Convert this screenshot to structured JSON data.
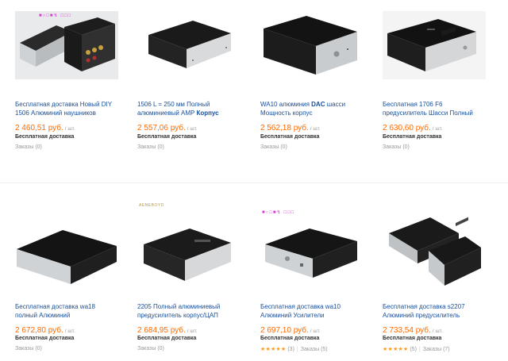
{
  "products": [
    {
      "title_lines": [
        "Бесплатная доставка Новый DIY",
        "1506 Алюминий наушников"
      ],
      "price": "2 460,51 руб.",
      "unit": "/ шт.",
      "shipping": "Бесплатная доставка",
      "orders": "Заказы (0)",
      "image_watermark": "■○□■↯ □□□"
    },
    {
      "title_lines": [
        "1506 L = 250 мм Полный",
        "алюминиевый AMP "
      ],
      "title_bold": "Корпус",
      "price": "2 557,06 руб.",
      "unit": "/ шт.",
      "shipping": "Бесплатная доставка",
      "orders": "Заказы (0)"
    },
    {
      "title_lines": [
        "WA10 алюминия ",
        "Мощность корпус"
      ],
      "title_bold": "DAC",
      "title_after": " шасси",
      "price": "2 562,18 руб.",
      "unit": "/ шт.",
      "shipping": "Бесплатная доставка",
      "orders": "Заказы (0)"
    },
    {
      "title_lines": [
        "Бесплатная 1706 F6",
        "предусилитель Шасси Полный"
      ],
      "price": "2 630,60 руб.",
      "unit": "/ шт.",
      "shipping": "Бесплатная доставка",
      "orders": "Заказы (0)"
    },
    {
      "title_lines": [
        "Бесплатная доставка wa18",
        "полный Алюминий"
      ],
      "price": "2 672,80 руб.",
      "unit": "/ шт.",
      "shipping": "Бесплатная доставка",
      "orders": "Заказы (0)"
    },
    {
      "title_lines": [
        "2205 Полный алюминиевый",
        "предусилитель корпус/ЦАП"
      ],
      "price": "2 684,95 руб.",
      "unit": "/ шт.",
      "shipping": "Бесплатная доставка",
      "orders": "Заказы (0)",
      "image_watermark": "AENEBOYD"
    },
    {
      "title_lines": [
        "Бесплатная доставка wa10",
        "Алюминий Усилители"
      ],
      "price": "2 697,10 руб.",
      "unit": "/ шт.",
      "shipping": "Бесплатная доставка",
      "rating": 5,
      "stars": "★★★★★",
      "reviews": "(3)",
      "orders": "Заказы (5)",
      "image_watermark": "■○□■↯ □□□"
    },
    {
      "title_lines": [
        "Бесплатная доставка s2207",
        "Алюминий предусилитель"
      ],
      "price": "2 733,54 руб.",
      "unit": "/ шт.",
      "shipping": "Бесплатная доставка",
      "rating": 4.5,
      "stars": "★★★★★",
      "reviews": "(5)",
      "orders": "Заказы (7)"
    }
  ],
  "colors": {
    "price": "#ff6a00",
    "title_link": "#1a4f99",
    "star": "#ff9a1f",
    "chassis_black": "#141414",
    "chassis_silver": "#cfd2d4"
  }
}
